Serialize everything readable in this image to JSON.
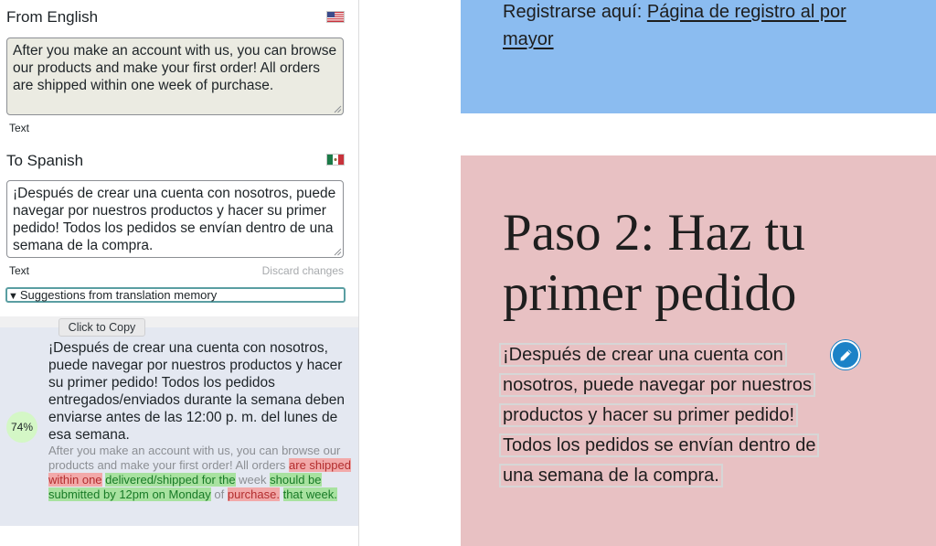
{
  "source": {
    "title": "From English",
    "flag_icon": "us-flag-icon",
    "text": "After you make an account with us, you can browse our products and make your first order! All orders are shipped within one week of purchase.",
    "field_label": "Text"
  },
  "target": {
    "title": "To Spanish",
    "flag_icon": "mexico-flag-icon",
    "text": "¡Después de crear una cuenta con nosotros, puede navegar por nuestros productos y hacer su primer pedido! Todos los pedidos se envían dentro de una semana de la compra.",
    "field_label": "Text",
    "discard_label": "Discard changes"
  },
  "memory": {
    "toggle_label": "Suggestions from translation memory",
    "tooltip": "Click to Copy",
    "score": "74%",
    "suggestion": "¡Después de crear una cuenta con nosotros, puede navegar por nuestros productos y hacer su primer pedido! Todos los pedidos entregados/enviados durante la semana deben enviarse antes de las 12:00 p. m. del lunes de esa semana.",
    "diff": {
      "p1": "After you make an account with us, you can browse our products and make your first order! All orders ",
      "del1": "are shipped within one",
      "sp1": " ",
      "ins1": "delivered/shipped for the",
      "p2": " week ",
      "ins2": "should be submitted by 12pm on Monday",
      "p3": " of ",
      "del2": "purchase.",
      "sp2": " ",
      "ins3": "that week."
    },
    "colors": {
      "deleted": "#f2a9a9",
      "inserted": "#a8e2a0",
      "score_bg": "#d4f7c6"
    }
  },
  "preview": {
    "register_prefix": "Registrarse aquí: ",
    "register_link": "Página de registro al por mayor",
    "heading": "Paso 2: Haz tu primer pedido",
    "paragraph": "¡Después de crear una cuenta con nosotros, puede navegar por nuestros productos y hacer su primer pedido! Todos los pedidos se envían dentro de una semana de la compra.",
    "edit_icon": "pencil-icon",
    "colors": {
      "blue_block": "#8bbcf0",
      "pink_block": "#e8c1c3",
      "edit_button": "#1b82c7"
    }
  }
}
